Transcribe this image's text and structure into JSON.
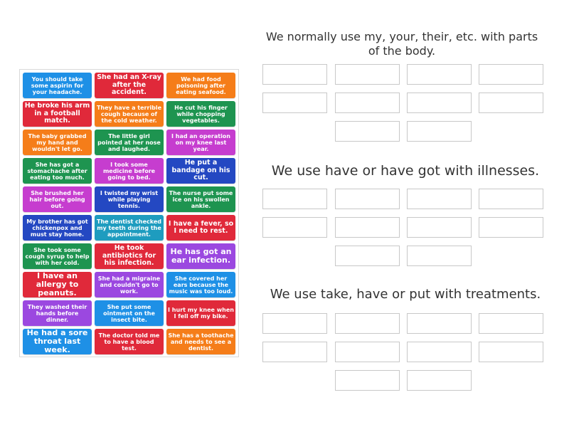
{
  "groups": [
    {
      "heading": "We normally use my, your, their, etc. with parts of the body.",
      "slots": 10
    },
    {
      "heading": "We use have or have got with illnesses.",
      "slots": 10
    },
    {
      "heading": "We use take, have or put with treatments.",
      "slots": 10
    }
  ],
  "cards": [
    {
      "text": "You should take some aspirin for your headache.",
      "color": "#1e90e6"
    },
    {
      "text": "She had an X-ray after the accident.",
      "color": "#e0293a"
    },
    {
      "text": "We had food poisoning after eating seafood.",
      "color": "#f57d19"
    },
    {
      "text": "He broke his arm in a football match.",
      "color": "#e0293a"
    },
    {
      "text": "They have a terrible cough because of the cold weather.",
      "color": "#f57d19"
    },
    {
      "text": "He cut his finger while chopping vegetables.",
      "color": "#1e9450"
    },
    {
      "text": "The baby grabbed my hand and wouldn't let go.",
      "color": "#f57d19"
    },
    {
      "text": "The little girl pointed at her nose and laughed.",
      "color": "#1e9450"
    },
    {
      "text": "I had an operation on my knee last year.",
      "color": "#c63dcf"
    },
    {
      "text": "She has got a stomachache after eating too much.",
      "color": "#1e9450"
    },
    {
      "text": "I took some medicine before going to bed.",
      "color": "#c63dcf"
    },
    {
      "text": "He put a bandage on his cut.",
      "color": "#2448c2"
    },
    {
      "text": "She brushed her hair before going out.",
      "color": "#c63dcf"
    },
    {
      "text": "I twisted my wrist while playing tennis.",
      "color": "#2448c2"
    },
    {
      "text": "The nurse put some ice on his swollen ankle.",
      "color": "#1e9450"
    },
    {
      "text": "My brother has got chickenpox and must stay home.",
      "color": "#2448c2"
    },
    {
      "text": "The dentist checked my teeth during the appointment.",
      "color": "#1e9cbf"
    },
    {
      "text": "I have a fever, so I need to rest.",
      "color": "#e0293a"
    },
    {
      "text": "She took some cough syrup to help with her cold.",
      "color": "#1e9450"
    },
    {
      "text": "He took antibiotics for his infection.",
      "color": "#e0293a"
    },
    {
      "text": "He has got an ear infection.",
      "color": "#9b48e0"
    },
    {
      "text": "I have an allergy to peanuts.",
      "color": "#e0293a"
    },
    {
      "text": "She had a migraine and couldn't go to work.",
      "color": "#9b48e0"
    },
    {
      "text": "She covered her ears because the music was too loud.",
      "color": "#1e90e6"
    },
    {
      "text": "They washed their hands before dinner.",
      "color": "#9b48e0"
    },
    {
      "text": "She put some ointment on the insect bite.",
      "color": "#1e90e6"
    },
    {
      "text": "I hurt my knee when I fell off my bike.",
      "color": "#e0293a"
    },
    {
      "text": "He had a sore throat last week.",
      "color": "#1e90e6"
    },
    {
      "text": "The doctor told me to have a blood test.",
      "color": "#e0293a"
    },
    {
      "text": "She has a toothache and needs to see a dentist.",
      "color": "#f57d19"
    }
  ]
}
